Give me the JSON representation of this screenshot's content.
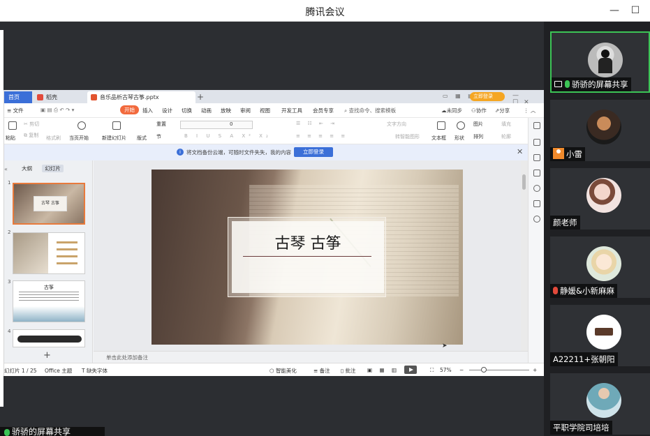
{
  "window": {
    "title": "腾讯会议",
    "minimize": "—",
    "maximize": "☐"
  },
  "shared_screen": {
    "banner": "骄骄的屏幕共享",
    "wps": {
      "tabs": [
        {
          "label": "首页"
        },
        {
          "label": "稻壳"
        },
        {
          "label": "音乐品析古琴古筝.pptx"
        }
      ],
      "tab_add": "+",
      "login_button": "立即登录",
      "menu": {
        "file": "≡ 文件",
        "items": [
          "开始",
          "插入",
          "设计",
          "切换",
          "动画",
          "放映",
          "审阅",
          "视图",
          "开发工具",
          "会员专享"
        ],
        "search": "查找命令、搜索模板",
        "right": [
          "未同步",
          "协作",
          "分享"
        ]
      },
      "ribbon": {
        "paste": "粘贴",
        "cut": "剪切",
        "copy": "复制",
        "format_painter": "格式刷",
        "from_current": "当页开始",
        "new_slide": "新建幻灯片",
        "layout": "版式",
        "section": "节",
        "reset": "重置",
        "font_size": "0",
        "text_box": "文本框",
        "shape": "形状",
        "arrange": "排列",
        "picture": "图片",
        "fill": "填充",
        "outline": "轮廓",
        "text_direction": "文字方向",
        "convert_smartart": "转智能图形",
        "more": "通"
      },
      "notice": {
        "message": "将文档备份云端，可随时文件失失，我的内容",
        "button": "立即登录"
      },
      "panel": {
        "tabs": [
          "大纲",
          "幻灯片"
        ],
        "slides": [
          {
            "num": "1",
            "title": "古琴 古筝"
          },
          {
            "num": "2",
            "title": ""
          },
          {
            "num": "3",
            "title": "古筝"
          },
          {
            "num": "4",
            "title": ""
          }
        ],
        "add": "+"
      },
      "slide": {
        "title": "古琴 古筝"
      },
      "notes_placeholder": "单击此处添加备注",
      "status": {
        "slide_count": "幻灯片 1 / 25",
        "theme": "Office 主题",
        "missing_fonts": "缺失字体",
        "smart_beautify": "智能美化",
        "notes": "备注",
        "comments": "批注",
        "zoom": "57%",
        "zoom_minus": "−",
        "zoom_plus": "+"
      }
    }
  },
  "participants": [
    {
      "name": "骄骄的屏幕共享",
      "sharing": true,
      "mic": "on"
    },
    {
      "name": "小雷",
      "mic": "none"
    },
    {
      "name": "颜老师",
      "mic": "none"
    },
    {
      "name": "静媛&小新麻麻",
      "mic": "muted"
    },
    {
      "name": "A22211+张朝阳",
      "mic": "none"
    },
    {
      "name": "平职学院司培培",
      "mic": "none"
    }
  ],
  "colors": {
    "accent_blue": "#3b6fd8",
    "active_green": "#3cc456",
    "tab_orange": "#f26a3d",
    "selected_thumb": "#e87a3c"
  }
}
